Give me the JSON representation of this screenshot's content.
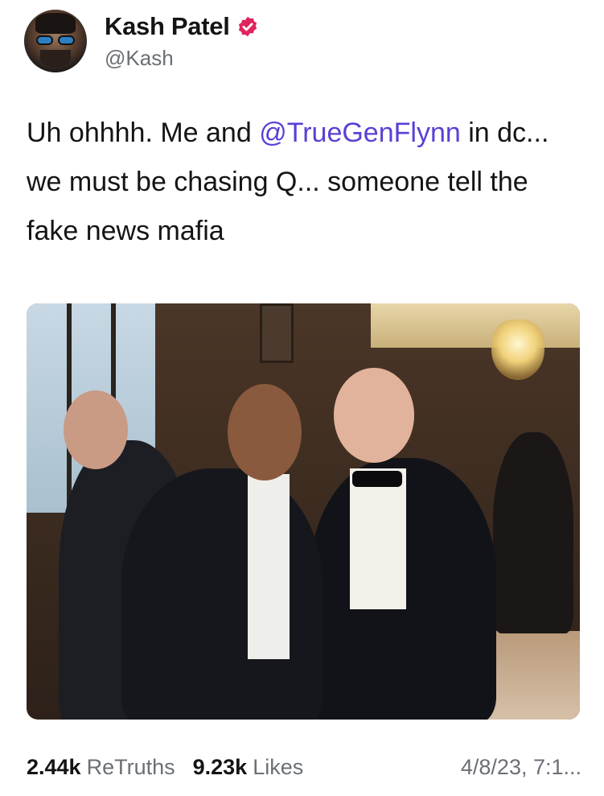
{
  "author": {
    "display_name": "Kash Patel",
    "handle": "@Kash",
    "verified": true,
    "avatar_icon": "user-avatar"
  },
  "post": {
    "text_before": "Uh ohhhh. Me and ",
    "mention": "@TrueGenFlynn",
    "text_after": " in dc... we must be chasing Q... someone tell the fake news mafia"
  },
  "stats": {
    "retruths_count": "2.44k",
    "retruths_label": "ReTruths",
    "likes_count": "9.23k",
    "likes_label": "Likes",
    "timestamp": "4/8/23, 7:1..."
  },
  "colors": {
    "mention": "#5b3fd6",
    "verified_badge": "#e0245e",
    "secondary_text": "#6b6f76"
  }
}
